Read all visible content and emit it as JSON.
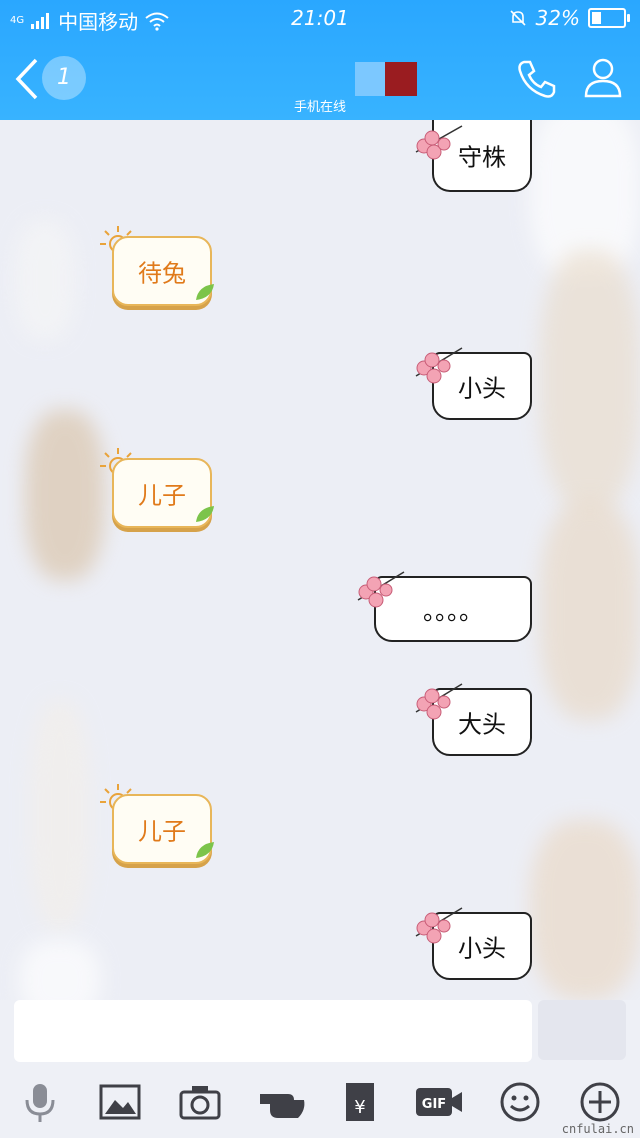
{
  "status_bar": {
    "carrier": "中国移动",
    "network": "4G",
    "time": "21:01",
    "battery": "32%",
    "battery_level": 0.32
  },
  "header": {
    "unread_count": "1",
    "subtitle": "手机在线"
  },
  "messages": [
    {
      "side": "right",
      "text": "守株"
    },
    {
      "side": "left",
      "text": "待兔"
    },
    {
      "side": "right",
      "text": "小头"
    },
    {
      "side": "left",
      "text": "儿子"
    },
    {
      "side": "right",
      "text": "。。。。"
    },
    {
      "side": "right",
      "text": "大头"
    },
    {
      "side": "left",
      "text": "儿子"
    },
    {
      "side": "right",
      "text": "小头"
    }
  ],
  "input": {
    "placeholder": "",
    "value": ""
  },
  "toolbar": [
    "mic-icon",
    "image-icon",
    "camera-icon",
    "poke-icon",
    "red-envelope-icon",
    "gif-icon",
    "emoji-icon",
    "plus-icon"
  ],
  "watermark": "cnfulai.cn",
  "colors": {
    "header": "#2aa7ff",
    "left_bubble_text": "#e07a1a",
    "left_bubble_border": "#e8b659"
  }
}
